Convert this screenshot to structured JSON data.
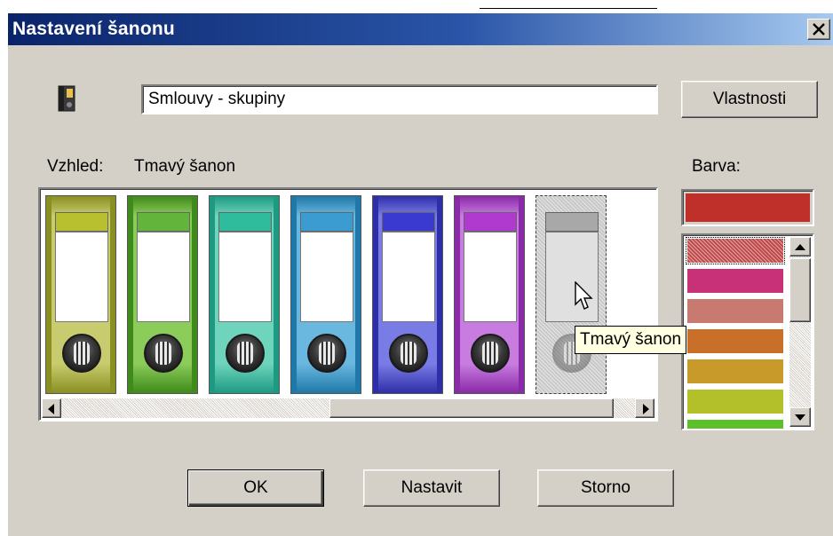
{
  "window": {
    "title": "Nastavení šanonu",
    "close_symbol": "✕"
  },
  "name_field": {
    "value": "Smlouvy - skupiny"
  },
  "buttons": {
    "properties": "Vlastnosti",
    "ok": "OK",
    "set": "Nastavit",
    "cancel": "Storno"
  },
  "appearance": {
    "label": "Vzhled:",
    "value": "Tmavý šanon"
  },
  "color": {
    "label": "Barva:",
    "selected": "#c0302a",
    "options": [
      "#c04a4a",
      "#c83078",
      "#c87a70",
      "#c8702a",
      "#c89a2a",
      "#b4c02a",
      "#5cc02a"
    ]
  },
  "binders": [
    {
      "name": "olive-binder",
      "body": "#c8cc6e",
      "dark": "#8a8f22",
      "strip": "#b8c030"
    },
    {
      "name": "green-binder",
      "body": "#8ccc5a",
      "dark": "#3e8a1a",
      "strip": "#62b43a"
    },
    {
      "name": "teal-binder",
      "body": "#6ed4bc",
      "dark": "#1e9a82",
      "strip": "#2ebc9c"
    },
    {
      "name": "blue-binder",
      "body": "#6ab8e0",
      "dark": "#1e78a8",
      "strip": "#3a9cd0"
    },
    {
      "name": "indigo-binder",
      "body": "#7a7ce6",
      "dark": "#2e2ea8",
      "strip": "#3a3ad0"
    },
    {
      "name": "purple-binder",
      "body": "#c87ce0",
      "dark": "#8a2aa8",
      "strip": "#b03ad0"
    },
    {
      "name": "grey-binder",
      "body": "#c8c8c8",
      "dark": "#8a8a8a",
      "strip": "#a0a0a0"
    }
  ],
  "tooltip": {
    "text": "Tmavý šanon"
  }
}
